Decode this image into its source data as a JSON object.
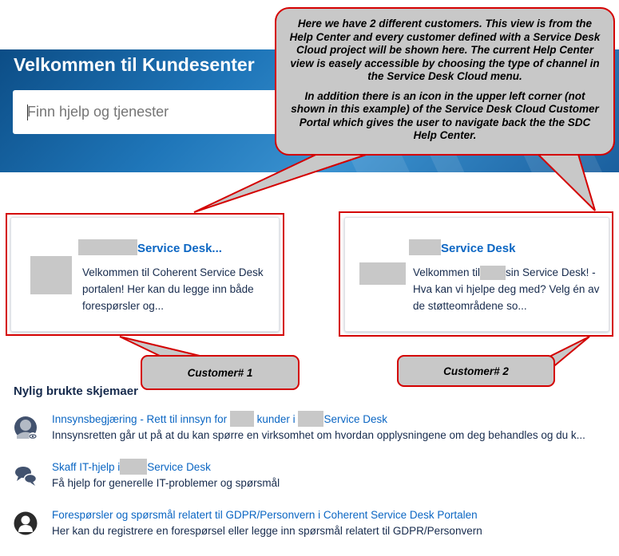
{
  "hero": {
    "title": "Velkommen til Kundesenter",
    "search_placeholder": "Finn hjelp og tjenester"
  },
  "annotation": {
    "paragraph1": "Here we have 2 different customers. This view is from the Help Center and every customer defined with a Service Desk Cloud project will be shown here. The current Help Center view is easely accessible by choosing the type of channel in the Service Desk Cloud menu.",
    "paragraph2": "In addition there is an icon in the upper left corner (not shown in this example) of the Service Desk Cloud Customer Portal which gives the user to navigate back the the SDC Help Center."
  },
  "cards": [
    {
      "title": "Service Desk...",
      "desc": "Velkommen til Coherent Service Desk portalen! Her kan du legge inn både forespørsler og..."
    },
    {
      "title": "Service Desk",
      "desc_before": "Velkommen til",
      "desc_after": "sin Service Desk! - Hva kan vi hjelpe deg med? Velg én av de støtteområdene so..."
    }
  ],
  "customer_labels": [
    "Customer# 1",
    "Customer# 2"
  ],
  "recent": {
    "title": "Nylig brukte skjemaer",
    "items": [
      {
        "icon": "user-privacy-icon",
        "title_part1": "Innsynsbegjæring - Rett til innsyn for",
        "title_part2": "kunder i",
        "title_part3": "Service Desk",
        "desc": "Innsynsretten går ut på at du kan spørre en virksomhet om hvordan opplysningene om deg behandles og du k..."
      },
      {
        "icon": "chat-bubbles-icon",
        "title_part1": "Skaff IT-hjelp i",
        "title_part2": "Service Desk",
        "desc": "Få hjelp for generelle IT-problemer og spørsmål"
      },
      {
        "icon": "person-silhouette-icon",
        "title_part1": "Forespørsler og spørsmål relatert til GDPR/Personvern i Coherent Service Desk Portalen",
        "desc": "Her kan du registrere en forespørsel eller legge inn spørsmål relatert til GDPR/Personvern"
      }
    ]
  },
  "colors": {
    "link": "#0b66c3",
    "annotation_border": "#d40000",
    "annotation_fill": "#c8c8c8",
    "hero": "#1f76b9"
  }
}
